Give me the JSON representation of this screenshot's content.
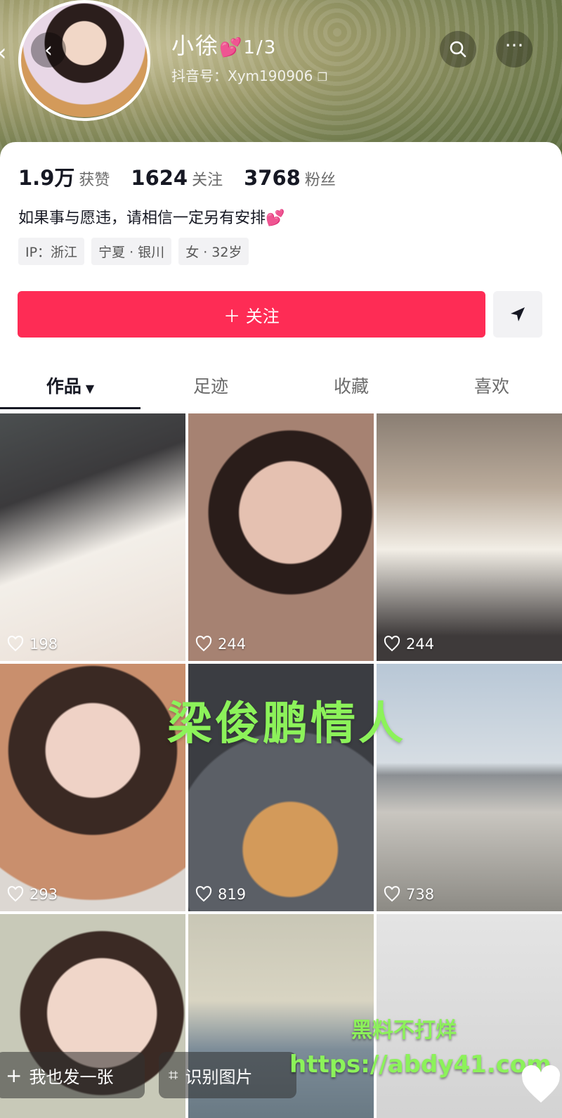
{
  "header": {
    "name": "小徐",
    "name_emoji": "💕",
    "photo_counter": "1/3",
    "douyin_id": "抖音号：Xym190906"
  },
  "stats": [
    {
      "value": "1.9万",
      "label": "获赞"
    },
    {
      "value": "1624",
      "label": "关注"
    },
    {
      "value": "3768",
      "label": "粉丝"
    }
  ],
  "bio": {
    "text": "如果事与愿违，请相信一定另有安排",
    "emoji": "💕"
  },
  "tags": [
    "IP：浙江",
    "宁夏 · 银川",
    "女 · 32岁"
  ],
  "actions": {
    "follow_label": "＋ 关注"
  },
  "tabs": [
    {
      "label": "作品",
      "caret": "▼"
    },
    {
      "label": "足迹"
    },
    {
      "label": "收藏"
    },
    {
      "label": "喜欢"
    }
  ],
  "videos": [
    {
      "likes": "198"
    },
    {
      "likes": "244"
    },
    {
      "likes": "244"
    },
    {
      "likes": "293"
    },
    {
      "likes": "819"
    },
    {
      "likes": "738"
    }
  ],
  "overlay": {
    "caption": "梁俊鹏情人"
  },
  "bottom_bar": {
    "post_label": "我也发一张",
    "identify_label": "识别图片"
  },
  "watermark": {
    "line1": "黑料不打烊",
    "line2": "https://abdy41.com"
  },
  "colors": {
    "follow": "#fe2c55",
    "overlay_text": "#8cf25a",
    "emoji_heart": "#ff4fa7"
  }
}
